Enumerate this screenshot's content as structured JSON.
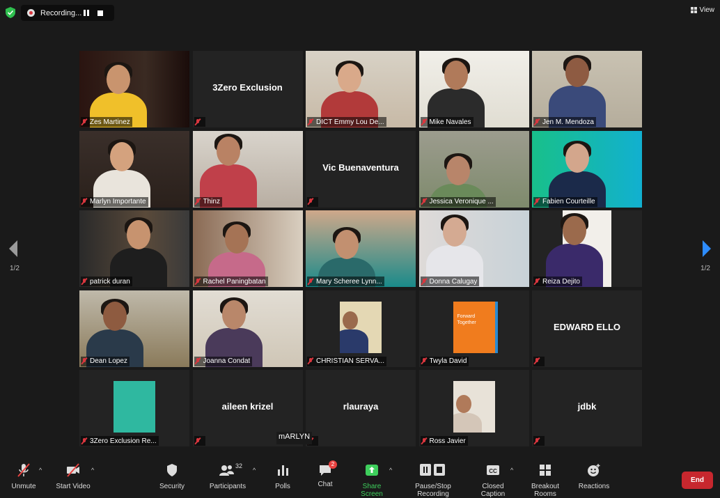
{
  "recording": {
    "text": "Recording..."
  },
  "view_label": "View",
  "pagination": {
    "left": "1/2",
    "right": "1/2"
  },
  "participants": [
    {
      "name": "Zes Martinez",
      "video": true
    },
    {
      "name": "3Zero Exclusion",
      "video": false
    },
    {
      "name": "DICT Emmy Lou De...",
      "video": true
    },
    {
      "name": "Mike Navales",
      "video": true
    },
    {
      "name": "Jen M. Mendoza",
      "video": true
    },
    {
      "name": "Marlyn Importante",
      "video": true,
      "active": true
    },
    {
      "name": "Thinz",
      "video": true
    },
    {
      "name": "Vic Buenaventura",
      "video": false
    },
    {
      "name": "Jessica Veronique ...",
      "video": true
    },
    {
      "name": "Fabien Courteille",
      "video": true
    },
    {
      "name": "patrick duran",
      "video": true
    },
    {
      "name": "Rachel Paningbatan",
      "video": true
    },
    {
      "name": "Mary Scheree Lynn...",
      "video": true
    },
    {
      "name": "Donna Calugay",
      "video": true
    },
    {
      "name": "Reiza Dejito",
      "video": true
    },
    {
      "name": "Dean Lopez",
      "video": true
    },
    {
      "name": "Joanna Condat",
      "video": true
    },
    {
      "name": "CHRISTIAN SERVA...",
      "video": true
    },
    {
      "name": "Twyla David",
      "video": true
    },
    {
      "name": "EDWARD ELLO",
      "video": false
    },
    {
      "name": "3Zero Exclusion Re...",
      "video": true
    },
    {
      "name": "aileen krizel",
      "video": false
    },
    {
      "name": "rlauraya",
      "video": false
    },
    {
      "name": "Ross Javier",
      "video": true
    },
    {
      "name": "jdbk",
      "video": false
    }
  ],
  "floating_name": "mARLYN",
  "poster_text": {
    "line1": "Forward",
    "line2": "Together"
  },
  "toolbar": {
    "unmute": "Unmute",
    "start_video": "Start Video",
    "security": "Security",
    "participants": "Participants",
    "participants_count": "32",
    "polls": "Polls",
    "chat": "Chat",
    "chat_badge": "2",
    "share_screen": "Share Screen",
    "pause_recording": "Pause/Stop Recording",
    "closed_caption": "Closed Caption",
    "breakout_rooms": "Breakout Rooms",
    "reactions": "Reactions",
    "end": "End"
  },
  "colors": {
    "background": "#1a1a1a",
    "tile": "#232323",
    "active_outline": "#e7e04a",
    "end_button": "#c7272e",
    "share_green": "#3ecf5c",
    "accent_blue": "#2d8cff"
  }
}
